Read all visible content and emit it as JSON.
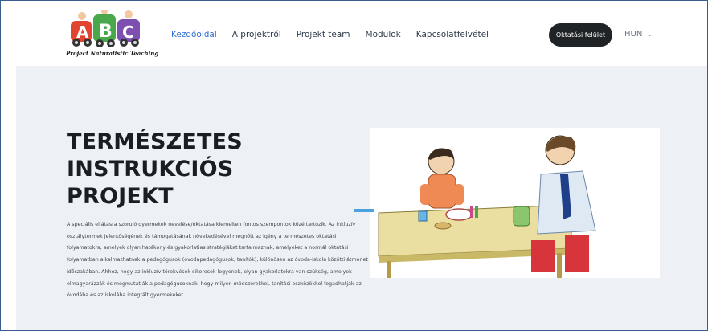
{
  "logo": {
    "letters": [
      "A",
      "B",
      "C"
    ],
    "tagline": "Project Naturalistic Teaching"
  },
  "nav": {
    "items": [
      {
        "label": "Kezdőoldal",
        "active": true
      },
      {
        "label": "A projektről",
        "active": false
      },
      {
        "label": "Projekt team",
        "active": false
      },
      {
        "label": "Modulok",
        "active": false
      },
      {
        "label": "Kapcsolatfelvétel",
        "active": false
      }
    ],
    "cta_label": "Oktatási felület",
    "language": "HUN"
  },
  "hero": {
    "title_lines": [
      "TERMÉSZETES",
      "INSTRUKCIÓS",
      "PROJEKT"
    ],
    "body": "A speciális ellátásra szoruló gyermekek nevelése/oktatása kiemelten fontos szempontok közé tartozik. Az inkluzív osztálytermek jelentőségének és támogatásának növekedésével megnőtt az igény a természetes oktatási folyamatokra, amelyek olyan hatékony és gyakorlatias stratégiákat tartalmaznak, amelyeket a normál oktatási folyamatban alkalmazhatnak a pedagógusok (óvodapedagógusok, tanítók), különösen az óvoda-iskola közötti átmenet időszakában. Ahhoz, hogy az inkluzív törekvések sikeresek legyenek, olyan gyakorlatokra van szükség, amelyek elmagyarázzák és megmutatják a pedagógusoknak, hogy milyen módszerekkel, tanítási eszközökkel fogadhatják az óvodába és az iskolába integrált gyermekeket."
  },
  "colors": {
    "accent": "#2f6fd1",
    "hero_bg": "#edf1f5",
    "cta_bg": "#1f2326"
  }
}
